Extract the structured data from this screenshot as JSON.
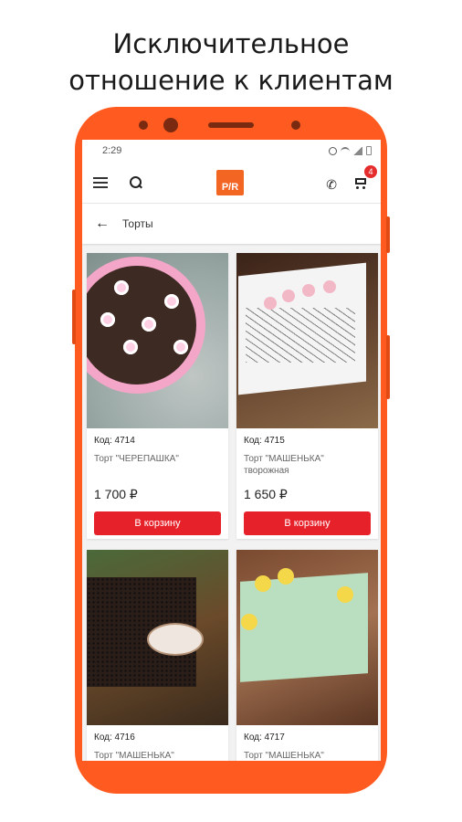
{
  "promo": {
    "line1": "Исключительное",
    "line2": "отношение к клиентам"
  },
  "status_bar": {
    "time": "2:29"
  },
  "app_bar": {
    "logo_text": "P/R",
    "cart_badge": "4"
  },
  "breadcrumb": {
    "back_icon": "arrow-left-icon",
    "title": "Торты"
  },
  "products": [
    {
      "code": "Код: 4714",
      "name": "Торт \"ЧЕРЕПАШКА\"",
      "price": "1 700 ₽",
      "button": "В корзину"
    },
    {
      "code": "Код: 4715",
      "name": "Торт \"МАШЕНЬКА\" творожная",
      "price": "1 650 ₽",
      "button": "В корзину"
    },
    {
      "code": "Код: 4716",
      "name": "Торт \"МАШЕНЬКА\"",
      "price": "",
      "button": ""
    },
    {
      "code": "Код: 4717",
      "name": "Торт \"МАШЕНЬКА\"",
      "price": "",
      "button": ""
    }
  ],
  "colors": {
    "phone_frame": "#ff5a1f",
    "button": "#e6212a",
    "logo": "#f26522"
  }
}
